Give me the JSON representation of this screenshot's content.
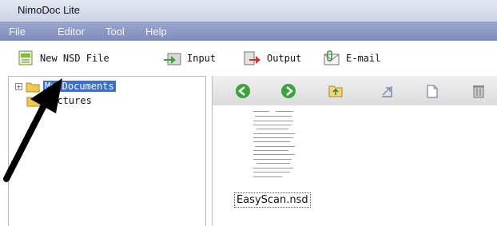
{
  "window": {
    "title": "NimoDoc Lite"
  },
  "menu": [
    "File",
    "Editor",
    "Tool",
    "Help"
  ],
  "toolbar": {
    "new_nsd": "New NSD File",
    "input": "Input",
    "output": "Output",
    "email": "E-mail"
  },
  "tree": {
    "items": [
      {
        "label": "My Documents",
        "visible_text": "Documents",
        "selected": true,
        "icon": "folder-icon",
        "expander": "+"
      },
      {
        "label": "Pictures",
        "selected": false,
        "icon": "folder-icon"
      }
    ]
  },
  "nav_icons": [
    "back-icon",
    "forward-icon",
    "folder-up-icon",
    "rotate-icon",
    "export-icon",
    "delete-icon"
  ],
  "files": [
    {
      "name": "EasyScan.nsd",
      "icon": "document-thumbnail-icon"
    }
  ],
  "colors": {
    "menubar": "#8896c4",
    "selection": "#3b6fd6",
    "nav_green": "#3aa43a"
  }
}
